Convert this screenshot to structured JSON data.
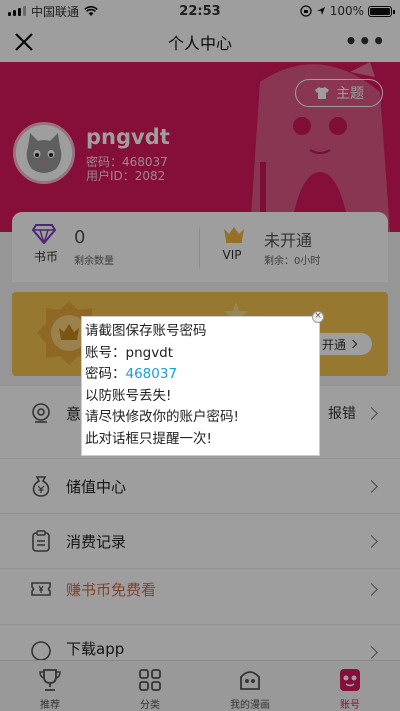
{
  "status_bar": {
    "carrier": "中国联通",
    "time": "22:53",
    "battery": "100%"
  },
  "nav": {
    "title": "个人中心",
    "more": "•••"
  },
  "profile": {
    "theme_button": "主题",
    "username": "pngvdt",
    "password_line": "密码：468037",
    "user_id_line": "用户ID：2082"
  },
  "stats": {
    "coins": {
      "label": "书币",
      "value": "0",
      "sub": "剩余数量"
    },
    "vip": {
      "label": "VIP",
      "value": "未开通",
      "sub": "剩余：0小时"
    }
  },
  "vip_banner": {
    "button": "开通"
  },
  "menu": {
    "feedback_label": "意见反馈",
    "feedback_right": "报错",
    "recharge": "储值中心",
    "records": "消费记录",
    "earn": "赚书币免费看",
    "download": "下载app"
  },
  "dialog": {
    "line1": "请截图保存账号密码",
    "account_prefix": "账号：",
    "account": "pngvdt",
    "password_prefix": "密码：",
    "password": "468037",
    "line4": "以防账号丢失!",
    "line5": "请尽快修改你的账户密码!",
    "line6": "此对话框只提醒一次!"
  },
  "tabs": [
    {
      "label": "推荐",
      "icon": "trophy-icon"
    },
    {
      "label": "分类",
      "icon": "category-icon"
    },
    {
      "label": "我的漫画",
      "icon": "bookshelf-icon"
    },
    {
      "label": "账号",
      "icon": "account-icon"
    }
  ],
  "colors": {
    "brand": "#d8195e",
    "vip_gold": "#f4c24f",
    "link_blue": "#1a9ed6"
  }
}
